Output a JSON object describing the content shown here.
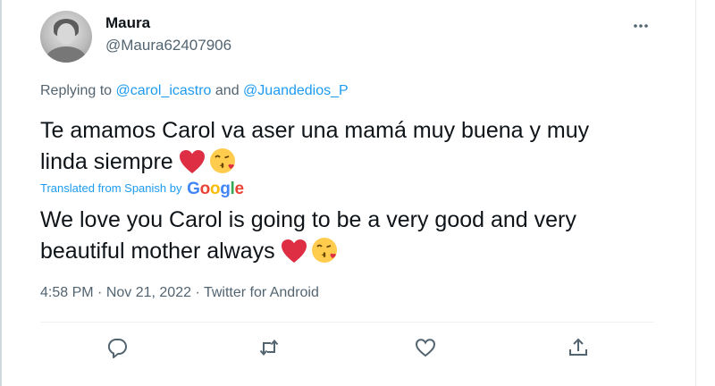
{
  "tweet": {
    "author_name": "Maura",
    "author_handle": "@Maura62407906",
    "reply": {
      "prefix": "Replying to ",
      "mention_1": "@carol_icastro",
      "joiner": " and ",
      "mention_2": "@Juandedios_P"
    },
    "original_text": {
      "line1": "Te amamos Carol va aser una mamá muy buena y muy",
      "line2": "linda siempre"
    },
    "translation": {
      "label": "Translated from Spanish by",
      "provider": "Google",
      "line1": "We love you Carol is going to be a very good and very",
      "line2": "beautiful mother always"
    },
    "meta": {
      "time": "4:58 PM",
      "date": "Nov 21, 2022",
      "source": "Twitter for Android",
      "separator": " · "
    }
  },
  "icons": {
    "more": "more-icon",
    "reply": "reply-icon",
    "retweet": "retweet-icon",
    "like": "like-icon",
    "share": "share-icon",
    "heart_emoji": "red-heart-emoji",
    "kiss_emoji": "face-blowing-kiss-emoji"
  },
  "colors": {
    "link": "#1d9bf0",
    "secondary_text": "#536471",
    "primary_text": "#0f1419",
    "google_blue": "#4285f4",
    "google_red": "#ea4335",
    "google_yellow": "#fbbc05",
    "google_green": "#34a853"
  }
}
